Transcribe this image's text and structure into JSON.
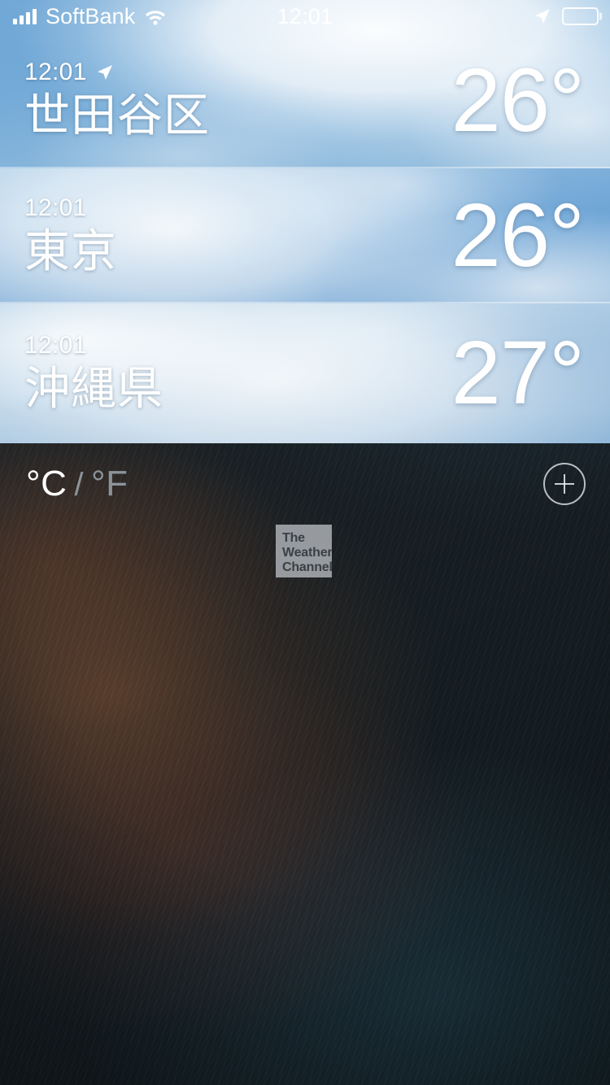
{
  "status_bar": {
    "carrier": "SoftBank",
    "time": "12:01",
    "signal_icon": "cellular-bars-icon",
    "wifi_icon": "wifi-icon",
    "location_icon": "location-arrow-icon",
    "battery_icon": "battery-full-icon",
    "battery_level": 100
  },
  "city_list": [
    {
      "time": "12:01",
      "name": "世田谷区",
      "temperature": "26°",
      "has_location_arrow": true,
      "condition": "partly-cloudy"
    },
    {
      "time": "12:01",
      "name": "東京",
      "temperature": "26°",
      "has_location_arrow": false,
      "condition": "cloudy"
    },
    {
      "time": "12:01",
      "name": "沖縄県",
      "temperature": "27°",
      "has_location_arrow": false,
      "condition": "hazy"
    }
  ],
  "toolbar": {
    "unit_celsius": "°C",
    "unit_separator": "/",
    "unit_fahrenheit": "°F",
    "selected_unit": "°C",
    "add_button_icon": "plus-circle-icon"
  },
  "attribution": {
    "line1": "The",
    "line2": "Weather",
    "line3": "Channel"
  },
  "colors": {
    "selected_unit": "#ffffff",
    "unselected_unit": "#8c949a",
    "row_text": "#ffffff",
    "logo_background": "#a4a7ac",
    "logo_text": "#3a4045"
  }
}
